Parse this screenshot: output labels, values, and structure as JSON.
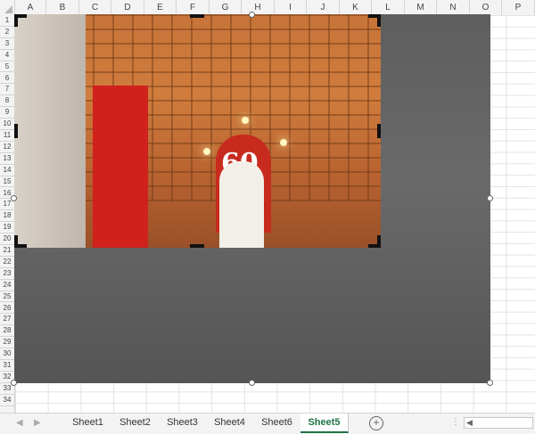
{
  "columns": [
    "A",
    "B",
    "C",
    "D",
    "E",
    "F",
    "G",
    "H",
    "I",
    "J",
    "K",
    "L",
    "M",
    "N",
    "O",
    "P"
  ],
  "rows": [
    "1",
    "2",
    "3",
    "4",
    "5",
    "6",
    "7",
    "8",
    "9",
    "10",
    "11",
    "12",
    "13",
    "14",
    "15",
    "16",
    "17",
    "18",
    "19",
    "20",
    "21",
    "22",
    "23",
    "24",
    "25",
    "26",
    "27",
    "28",
    "29",
    "30",
    "31",
    "32",
    "33",
    "34"
  ],
  "picture": {
    "sign_text": "60"
  },
  "sheet_tabs": [
    {
      "label": "Sheet1",
      "active": false
    },
    {
      "label": "Sheet2",
      "active": false
    },
    {
      "label": "Sheet3",
      "active": false
    },
    {
      "label": "Sheet4",
      "active": false
    },
    {
      "label": "Sheet6",
      "active": false
    },
    {
      "label": "Sheet5",
      "active": true
    }
  ],
  "icons": {
    "add_sheet": "+",
    "nav_prev": "◀",
    "nav_next": "▶",
    "scroll_left": "◀",
    "options": "⋮"
  },
  "colors": {
    "accent": "#217346",
    "banner_red": "#d0211c"
  }
}
